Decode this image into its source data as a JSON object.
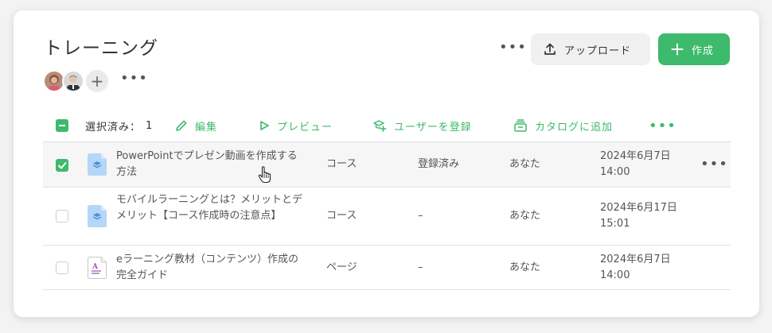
{
  "header": {
    "title": "トレーニング",
    "upload_label": "アップロード",
    "create_label": "作成",
    "more_label": "•••"
  },
  "members": {
    "more_label": "•••",
    "add_label": "+"
  },
  "toolbar": {
    "selected_label": "選択済み：",
    "selected_count": "1",
    "edit_label": "編集",
    "preview_label": "プレビュー",
    "enroll_label": "ユーザーを登録",
    "catalog_label": "カタログに追加",
    "more_label": "•••"
  },
  "rows": [
    {
      "selected": true,
      "icon": "course-layers-icon",
      "name": "PowerPointでプレゼン動画を作成する方法",
      "type": "コース",
      "status": "登録済み",
      "owner": "あなた",
      "date": "2024年6月7日 14:00",
      "more_label": "•••"
    },
    {
      "selected": false,
      "icon": "course-layers-icon",
      "name": "モバイルラーニングとは？メリットとデメリット【コース作成時の注意点】",
      "type": "コース",
      "status": "–",
      "owner": "あなた",
      "date": "2024年6月17日 15:01"
    },
    {
      "selected": false,
      "icon": "page-document-icon",
      "name": "eラーニング教材（コンテンツ）作成の完全ガイド",
      "type": "ページ",
      "status": "–",
      "owner": "あなた",
      "date": "2024年6月7日 14:00"
    }
  ],
  "colors": {
    "accent": "#3dba6b",
    "course_icon": "#b5d6f7",
    "course_icon_mark": "#4a90d9"
  }
}
